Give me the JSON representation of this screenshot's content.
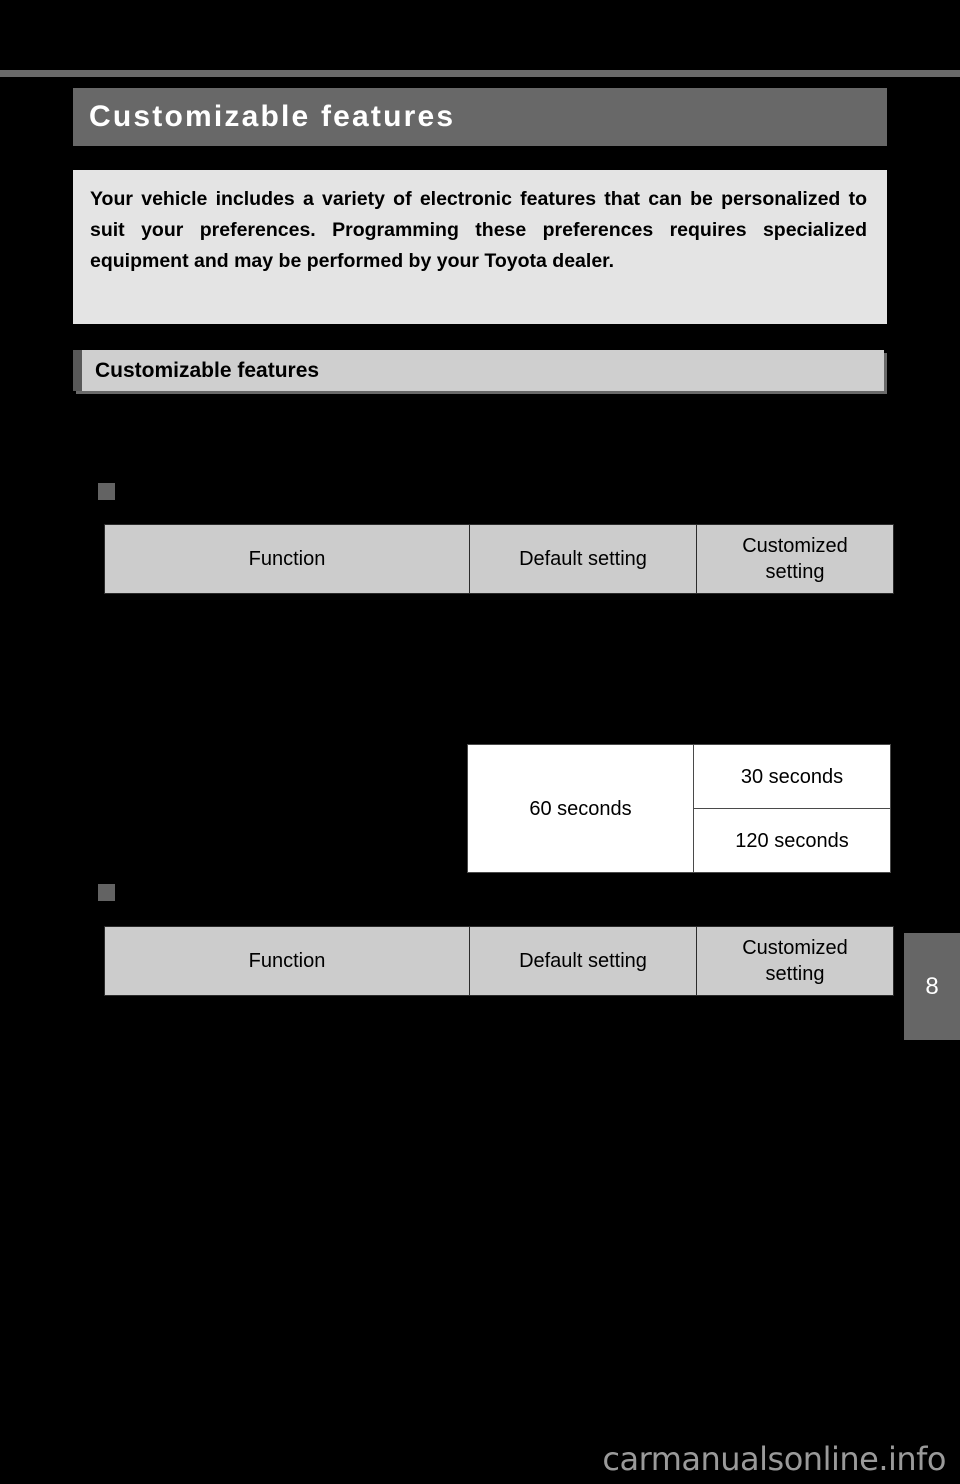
{
  "page": {
    "background_color": "#000000",
    "chapter_number": "8",
    "watermark": "carmanualsonline.info"
  },
  "chapter_title": {
    "text": "Customizable features",
    "bar_color": "#686868",
    "text_color": "#ffffff"
  },
  "intro": {
    "text": "Your vehicle includes a variety of electronic features that can be personalized to suit your preferences. Programming these preferences requires specialized equipment and may be performed by your Toyota dealer.",
    "background_color": "#e4e4e4"
  },
  "section": {
    "label": "Customizable features",
    "bar_color": "#cfcfcf",
    "tick_color": "#585858"
  },
  "tables": {
    "columns": {
      "function": "Function",
      "default_setting": "Default setting",
      "customized_setting": "Customized setting",
      "customized_setting_line1": "Customized",
      "customized_setting_line2": "setting"
    },
    "header_background": "#cccccc",
    "data_rows": [
      {
        "default": "60 seconds",
        "customized": [
          "30 seconds",
          "120 seconds"
        ]
      }
    ]
  }
}
